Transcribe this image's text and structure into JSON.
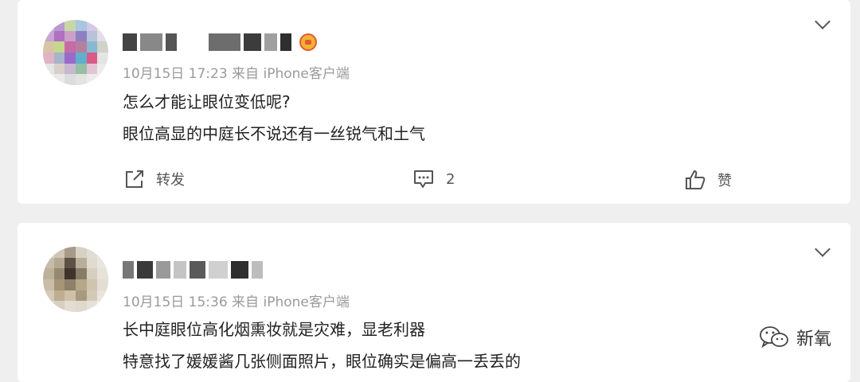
{
  "comments": [
    {
      "username": "",
      "meta": "10月15日 17:23 来自 iPhone客户端",
      "lines": [
        "怎么才能让眼位变低呢?",
        "眼位高显的中庭长不说还有一丝锐气和土气"
      ],
      "actions": {
        "repost_label": "转发",
        "comment_count": "2",
        "like_label": "赞"
      }
    },
    {
      "username": "",
      "meta": "10月15日 15:36 来自 iPhone客户端",
      "lines": [
        "长中庭眼位高化烟熏妆就是灾难，显老利器",
        "特意找了媛媛酱几张侧面照片，眼位确实是偏高一丢丢的"
      ]
    }
  ],
  "watermark": {
    "text": "新氧",
    "icon": "wechat-icon"
  },
  "colors": {
    "background": "#efefef",
    "card": "#ffffff",
    "meta": "#9a9a9a",
    "text": "#222222"
  }
}
